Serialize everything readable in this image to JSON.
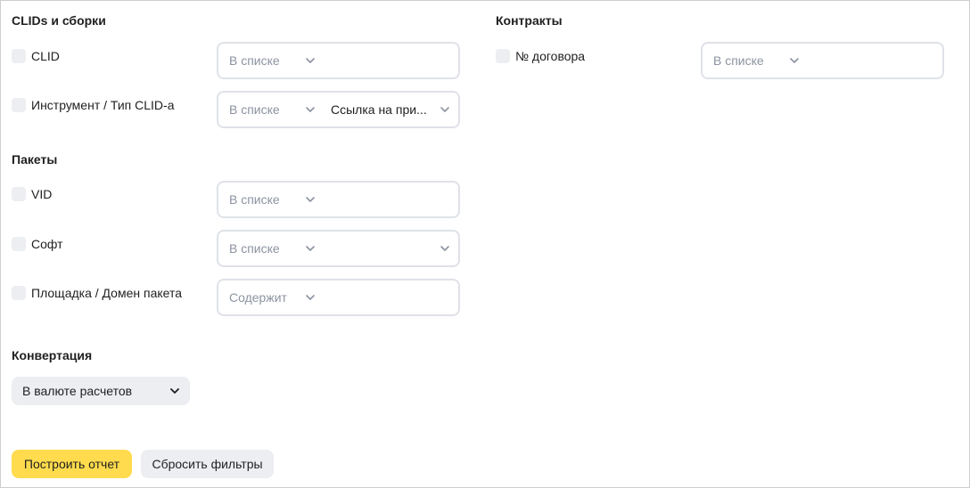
{
  "sections": {
    "clids": {
      "title": "CLIDs и сборки",
      "rows": [
        {
          "label": "CLID",
          "operator": "В списке",
          "value": ""
        },
        {
          "label": "Инструмент / Тип CLID-а",
          "operator": "В списке",
          "value": "Ссылка на при..."
        }
      ]
    },
    "packages": {
      "title": "Пакеты",
      "rows": [
        {
          "label": "VID",
          "operator": "В списке",
          "value": ""
        },
        {
          "label": "Софт",
          "operator": "В списке",
          "value": ""
        },
        {
          "label": "Площадка / Домен пакета",
          "operator": "Содержит",
          "value": ""
        }
      ]
    },
    "contracts": {
      "title": "Контракты",
      "rows": [
        {
          "label": "№ договора",
          "operator": "В списке",
          "value": ""
        }
      ]
    },
    "conversion": {
      "title": "Конвертация",
      "selected": "В валюте расчетов"
    }
  },
  "actions": {
    "build_label": "Построить отчет",
    "reset_label": "Сбросить фильтры"
  },
  "colors": {
    "primary": "#ffdb4d",
    "muted_bg": "#eceef2",
    "border": "#dfe2e8",
    "placeholder": "#8c93a1"
  },
  "icons": [
    "chevron-down-icon"
  ]
}
